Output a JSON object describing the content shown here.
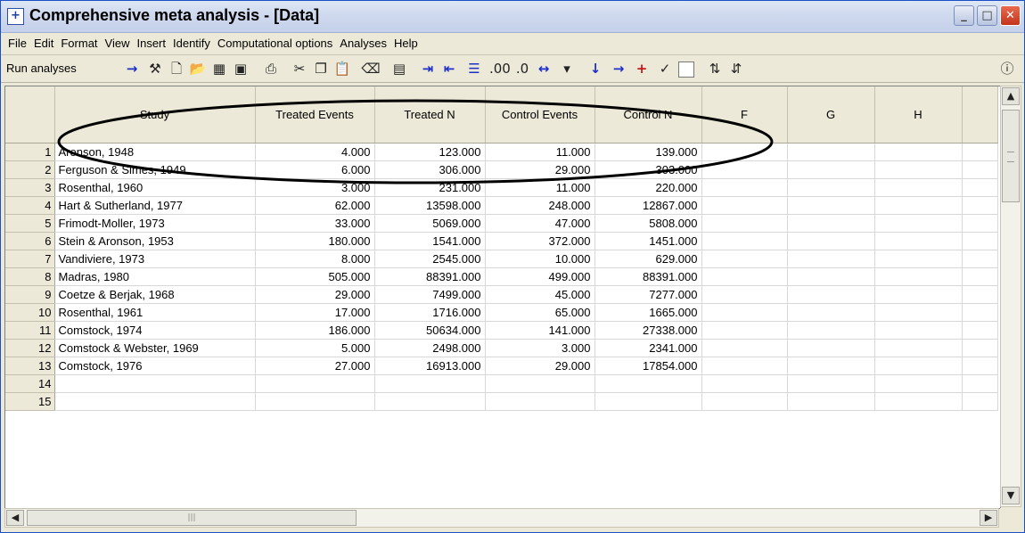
{
  "window": {
    "title": "Comprehensive meta analysis - [Data]"
  },
  "menu": [
    "File",
    "Edit",
    "Format",
    "View",
    "Insert",
    "Identify",
    "Computational options",
    "Analyses",
    "Help"
  ],
  "toolbar": {
    "run_label": "Run analyses",
    "icons": [
      "run-arrow-icon",
      "wand-icon",
      "new-icon",
      "open-icon",
      "table-icon",
      "save-icon",
      "print-icon",
      "cut-icon",
      "copy-icon",
      "paste-icon",
      "eraser-icon",
      "grid-icon",
      "indent-icon",
      "outdent-icon",
      "list-icon",
      "decimals-increase-icon",
      "decimals-decrease-icon",
      "column-width-icon",
      "dropdown-icon",
      "move-down-icon",
      "move-right-icon",
      "add-icon",
      "check-icon",
      "checkbox-icon",
      "sort-ascending-icon",
      "sort-descending-icon",
      "info-icon"
    ]
  },
  "grid": {
    "columns": [
      "Study",
      "Treated Events",
      "Treated N",
      "Control Events",
      "Control N",
      "F",
      "G",
      "H"
    ],
    "rows": [
      {
        "num": "1",
        "study": "Aronson, 1948",
        "te": "4.000",
        "tn": "123.000",
        "ce": "11.000",
        "cn": "139.000"
      },
      {
        "num": "2",
        "study": "Ferguson & Simes, 1949",
        "te": "6.000",
        "tn": "306.000",
        "ce": "29.000",
        "cn": "303.000"
      },
      {
        "num": "3",
        "study": "Rosenthal, 1960",
        "te": "3.000",
        "tn": "231.000",
        "ce": "11.000",
        "cn": "220.000"
      },
      {
        "num": "4",
        "study": "Hart & Sutherland, 1977",
        "te": "62.000",
        "tn": "13598.000",
        "ce": "248.000",
        "cn": "12867.000"
      },
      {
        "num": "5",
        "study": "Frimodt-Moller, 1973",
        "te": "33.000",
        "tn": "5069.000",
        "ce": "47.000",
        "cn": "5808.000"
      },
      {
        "num": "6",
        "study": "Stein & Aronson, 1953",
        "te": "180.000",
        "tn": "1541.000",
        "ce": "372.000",
        "cn": "1451.000"
      },
      {
        "num": "7",
        "study": "Vandiviere, 1973",
        "te": "8.000",
        "tn": "2545.000",
        "ce": "10.000",
        "cn": "629.000"
      },
      {
        "num": "8",
        "study": "Madras, 1980",
        "te": "505.000",
        "tn": "88391.000",
        "ce": "499.000",
        "cn": "88391.000"
      },
      {
        "num": "9",
        "study": "Coetze & Berjak, 1968",
        "te": "29.000",
        "tn": "7499.000",
        "ce": "45.000",
        "cn": "7277.000"
      },
      {
        "num": "10",
        "study": "Rosenthal, 1961",
        "te": "17.000",
        "tn": "1716.000",
        "ce": "65.000",
        "cn": "1665.000"
      },
      {
        "num": "11",
        "study": "Comstock, 1974",
        "te": "186.000",
        "tn": "50634.000",
        "ce": "141.000",
        "cn": "27338.000"
      },
      {
        "num": "12",
        "study": "Comstock & Webster, 1969",
        "te": "5.000",
        "tn": "2498.000",
        "ce": "3.000",
        "cn": "2341.000"
      },
      {
        "num": "13",
        "study": "Comstock, 1976",
        "te": "27.000",
        "tn": "16913.000",
        "ce": "29.000",
        "cn": "17854.000"
      },
      {
        "num": "14",
        "study": "",
        "te": "",
        "tn": "",
        "ce": "",
        "cn": ""
      },
      {
        "num": "15",
        "study": "",
        "te": "",
        "tn": "",
        "ce": "",
        "cn": ""
      }
    ]
  }
}
